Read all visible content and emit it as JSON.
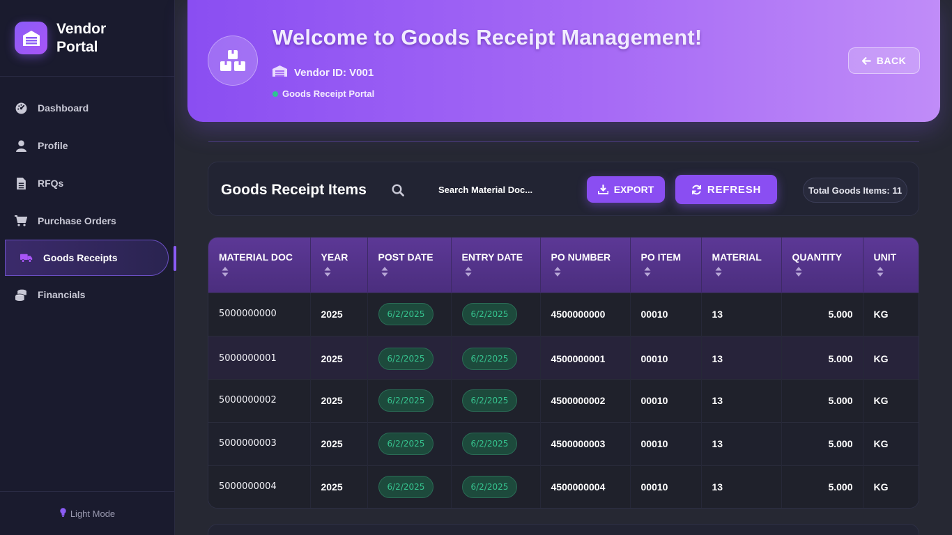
{
  "sidebar": {
    "brand": "Vendor Portal",
    "items": [
      {
        "label": "Dashboard",
        "icon": "dashboard-icon"
      },
      {
        "label": "Profile",
        "icon": "user-icon"
      },
      {
        "label": "RFQs",
        "icon": "document-icon"
      },
      {
        "label": "Purchase Orders",
        "icon": "cart-icon"
      },
      {
        "label": "Goods Receipts",
        "icon": "truck-icon",
        "active": true
      },
      {
        "label": "Financials",
        "icon": "coins-icon"
      }
    ],
    "footer": "Light Mode"
  },
  "banner": {
    "title": "Welcome to Goods Receipt Management!",
    "vendor_id": "Vendor ID: V001",
    "portal_tag": "Goods Receipt Portal",
    "back_label": "BACK"
  },
  "toolbar": {
    "title": "Goods Receipt Items",
    "search_placeholder": "Search Material Doc...",
    "export_label": "EXPORT",
    "refresh_label": "REFRESH",
    "total_label": "Total Goods Items: 11"
  },
  "table": {
    "columns": [
      "MATERIAL DOC",
      "YEAR",
      "POST DATE",
      "ENTRY DATE",
      "PO NUMBER",
      "PO ITEM",
      "MATERIAL",
      "QUANTITY",
      "UNIT"
    ],
    "rows": [
      [
        "5000000000",
        "2025",
        "6/2/2025",
        "6/2/2025",
        "4500000000",
        "00010",
        "13",
        "5.000",
        "KG"
      ],
      [
        "5000000001",
        "2025",
        "6/2/2025",
        "6/2/2025",
        "4500000001",
        "00010",
        "13",
        "5.000",
        "KG"
      ],
      [
        "5000000002",
        "2025",
        "6/2/2025",
        "6/2/2025",
        "4500000002",
        "00010",
        "13",
        "5.000",
        "KG"
      ],
      [
        "5000000003",
        "2025",
        "6/2/2025",
        "6/2/2025",
        "4500000003",
        "00010",
        "13",
        "5.000",
        "KG"
      ],
      [
        "5000000004",
        "2025",
        "6/2/2025",
        "6/2/2025",
        "4500000004",
        "00010",
        "13",
        "5.000",
        "KG"
      ]
    ]
  },
  "colors": {
    "accent": "#8a4ef2",
    "sidebar_bg": "#1a1b2e",
    "date_pill_text": "#36c48f"
  }
}
